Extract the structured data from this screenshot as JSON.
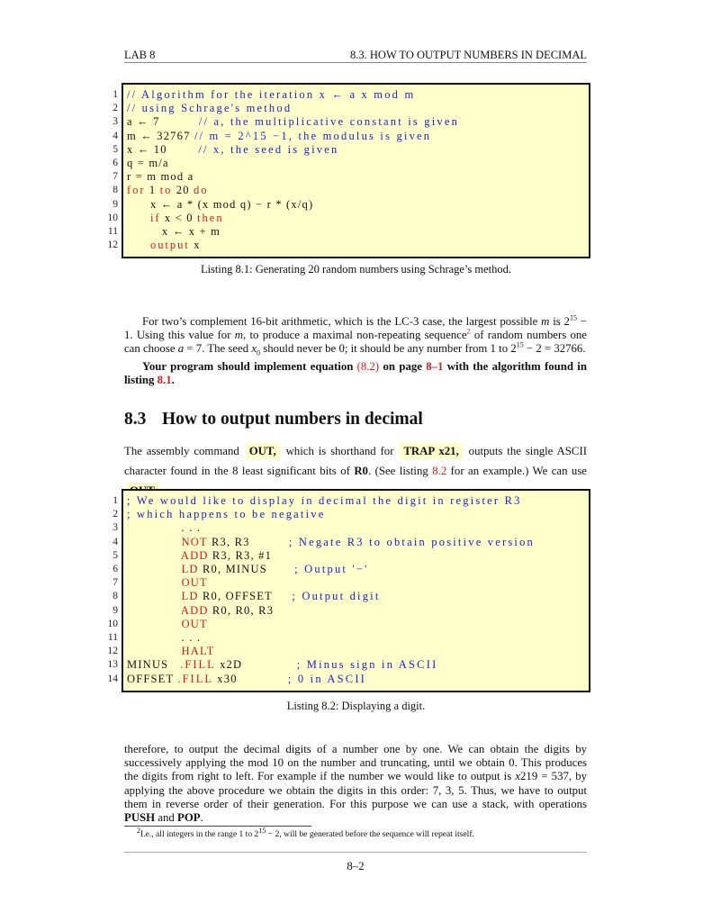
{
  "header": {
    "left": "LAB 8",
    "right": "8.3.  HOW TO OUTPUT NUMBERS IN DECIMAL"
  },
  "listing1": {
    "lines": [
      {
        "n": "1",
        "parts": [
          {
            "t": "// Algorithm for the iteration x ← a x mod m",
            "c": "com"
          }
        ]
      },
      {
        "n": "2",
        "parts": [
          {
            "t": "// using Schrage's method",
            "c": "com"
          }
        ]
      },
      {
        "n": "3",
        "parts": [
          {
            "t": "a ← 7          ",
            "c": "txt"
          },
          {
            "t": "// a, the multiplicative constant is given",
            "c": "com"
          }
        ]
      },
      {
        "n": "4",
        "parts": [
          {
            "t": "m ← 32767 ",
            "c": "txt"
          },
          {
            "t": "// m = 2^15 −1, the modulus is given",
            "c": "com"
          }
        ]
      },
      {
        "n": "5",
        "parts": [
          {
            "t": "x ← 10        ",
            "c": "txt"
          },
          {
            "t": "// x, the seed is given",
            "c": "com"
          }
        ]
      },
      {
        "n": "6",
        "parts": [
          {
            "t": "q = m/a",
            "c": "txt"
          }
        ]
      },
      {
        "n": "7",
        "parts": [
          {
            "t": "r = m mod a",
            "c": "txt"
          }
        ]
      },
      {
        "n": "8",
        "parts": [
          {
            "t": "for",
            "c": "kw"
          },
          {
            "t": " 1 ",
            "c": "txt"
          },
          {
            "t": "to",
            "c": "kw"
          },
          {
            "t": " 20 ",
            "c": "txt"
          },
          {
            "t": "do",
            "c": "kw"
          }
        ]
      },
      {
        "n": "9",
        "parts": [
          {
            "t": "      x ← a * (x mod q) − r * (x/q)",
            "c": "txt"
          }
        ]
      },
      {
        "n": "10",
        "parts": [
          {
            "t": "      ",
            "c": "txt"
          },
          {
            "t": "if",
            "c": "kw"
          },
          {
            "t": " x < 0 ",
            "c": "txt"
          },
          {
            "t": "then",
            "c": "kw"
          }
        ]
      },
      {
        "n": "11",
        "parts": [
          {
            "t": "         x ← x + m",
            "c": "txt"
          }
        ]
      },
      {
        "n": "12",
        "parts": [
          {
            "t": "      ",
            "c": "txt"
          },
          {
            "t": "output",
            "c": "kw"
          },
          {
            "t": " x",
            "c": "txt"
          }
        ]
      }
    ],
    "caption": "Listing 8.1: Generating 20 random numbers using Schrage’s method."
  },
  "para1": {
    "s1": "For two’s complement 16-bit arithmetic, which is the LC-3 case, the largest possible ",
    "m": "m",
    "s2": " is 2",
    "exp15": "15",
    "s3": " − 1. Using this value for ",
    "s4": ", to produce a maximal non-repeating sequence",
    "fnmark": "2",
    "s5": " of random numbers one can choose ",
    "a": "a",
    "s6": " = 7. The seed ",
    "x0": "x",
    "x0sub": "0",
    "s7": " should never be 0; it should be any number from 1 to 2",
    "s8": " − 2 = 32766."
  },
  "para2": {
    "b1": "Your program should implement equation ",
    "ref1": "(8.2)",
    "b2": " on page ",
    "ref2": "8–1",
    "b3": " with the algorithm found in listing ",
    "ref3": "8.1",
    "b4": "."
  },
  "section": {
    "number": "8.3",
    "title": "How to output numbers in decimal"
  },
  "para3": {
    "s1": "The assembly command ",
    "hl1": "OUT,",
    "s2": " which is shorthand for ",
    "hl2": "TRAP x21,",
    "s3": " outputs the single ASCII character found in the 8 least significant bits of ",
    "r0": "R0",
    "s4": ". (See listing ",
    "ref": "8.2",
    "s5": " for an example.)  We can use ",
    "hl3": "OUT,"
  },
  "listing2": {
    "lines": [
      {
        "n": "1",
        "parts": [
          {
            "t": "; We would like to display in decimal the digit in register R3",
            "c": "com"
          }
        ]
      },
      {
        "n": "2",
        "parts": [
          {
            "t": "; which happens to be negative",
            "c": "com"
          }
        ]
      },
      {
        "n": "3",
        "parts": [
          {
            "t": "              . . .",
            "c": "txt"
          }
        ]
      },
      {
        "n": "4",
        "parts": [
          {
            "t": "              ",
            "c": "txt"
          },
          {
            "t": "NOT",
            "c": "kwo"
          },
          {
            "t": " R3, R3          ",
            "c": "txt"
          },
          {
            "t": "; Negate R3 to obtain positive version",
            "c": "com"
          }
        ]
      },
      {
        "n": "5",
        "parts": [
          {
            "t": "              ",
            "c": "txt"
          },
          {
            "t": "ADD",
            "c": "kwo"
          },
          {
            "t": " R3, R3, #1",
            "c": "txt"
          }
        ]
      },
      {
        "n": "6",
        "parts": [
          {
            "t": "              ",
            "c": "txt"
          },
          {
            "t": "LD",
            "c": "kwo"
          },
          {
            "t": " R0, MINUS       ",
            "c": "txt"
          },
          {
            "t": "; Output '−'",
            "c": "com"
          }
        ]
      },
      {
        "n": "7",
        "parts": [
          {
            "t": "              ",
            "c": "txt"
          },
          {
            "t": "OUT",
            "c": "kwo"
          }
        ]
      },
      {
        "n": "8",
        "parts": [
          {
            "t": "              ",
            "c": "txt"
          },
          {
            "t": "LD",
            "c": "kwo"
          },
          {
            "t": " R0, OFFSET     ",
            "c": "txt"
          },
          {
            "t": "; Output digit",
            "c": "com"
          }
        ]
      },
      {
        "n": "9",
        "parts": [
          {
            "t": "              ",
            "c": "txt"
          },
          {
            "t": "ADD",
            "c": "kwo"
          },
          {
            "t": " R0, R0, R3",
            "c": "txt"
          }
        ]
      },
      {
        "n": "10",
        "parts": [
          {
            "t": "              ",
            "c": "txt"
          },
          {
            "t": "OUT",
            "c": "kwo"
          }
        ]
      },
      {
        "n": "11",
        "parts": [
          {
            "t": "              . . .",
            "c": "txt"
          }
        ]
      },
      {
        "n": "12",
        "parts": [
          {
            "t": "              ",
            "c": "txt"
          },
          {
            "t": "HALT",
            "c": "kwo"
          }
        ]
      },
      {
        "n": "13",
        "parts": [
          {
            "t": "MINUS   ",
            "c": "txt"
          },
          {
            "t": ".FILL",
            "c": "kw"
          },
          {
            "t": " x2D              ",
            "c": "txt"
          },
          {
            "t": "; Minus sign in ASCII",
            "c": "com"
          }
        ]
      },
      {
        "n": "14",
        "parts": [
          {
            "t": "OFFSET ",
            "c": "txt"
          },
          {
            "t": ".FILL",
            "c": "kw"
          },
          {
            "t": " x30             ",
            "c": "txt"
          },
          {
            "t": "; 0 in ASCII",
            "c": "com"
          }
        ]
      }
    ],
    "caption": "Listing 8.2:  Displaying a digit."
  },
  "para4": {
    "s1": "therefore, to output the decimal digits of a number one by one.  We can obtain the digits by successively applying the    mod 10 on the number and truncating, until we obtain 0.  This produces the digits from right to left. For example if the number we would like to output is ",
    "x219": "x",
    "s2": "219 = 537, by applying the above procedure we obtain the digits in this order: 7, 3, 5. Thus, we have to output them in reverse order of their generation. For this purpose we can use a stack, with operations ",
    "push": "PUSH",
    "s3": " and ",
    "pop": "POP",
    "s4": "."
  },
  "footnote": {
    "mark": "2",
    "s1": "I.e., all integers in the range 1 to 2",
    "exp": "15",
    "s2": " − 2, will be generated before the sequence will repeat itself."
  },
  "page_number": "8–2"
}
